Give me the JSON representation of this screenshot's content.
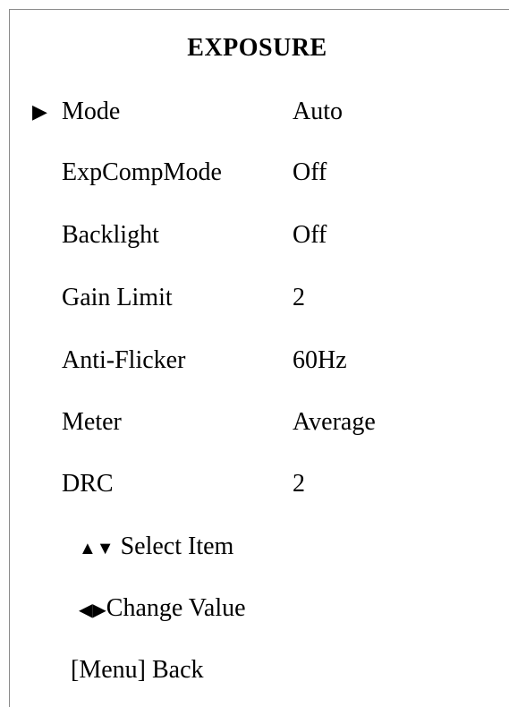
{
  "menu": {
    "title": "EXPOSURE",
    "cursor": "▶",
    "items": [
      {
        "label": "Mode",
        "value": "Auto"
      },
      {
        "label": "ExpCompMode",
        "value": "Off"
      },
      {
        "label": "Backlight",
        "value": "Off"
      },
      {
        "label": "Gain Limit",
        "value": "2"
      },
      {
        "label": "Anti-Flicker",
        "value": "60Hz"
      },
      {
        "label": "Meter",
        "value": "Average"
      },
      {
        "label": "DRC",
        "value": "2"
      }
    ],
    "selected_index": 0
  },
  "hints": {
    "select_arrows": "▲▼",
    "select_text": " Select Item",
    "change_arrows": "◀▶",
    "change_text": "Change Value",
    "back_text": "[Menu] Back"
  },
  "icons": {
    "cursor": "play-triangle-icon",
    "up_down": "up-down-arrows-icon",
    "left_right": "left-right-arrows-icon"
  }
}
